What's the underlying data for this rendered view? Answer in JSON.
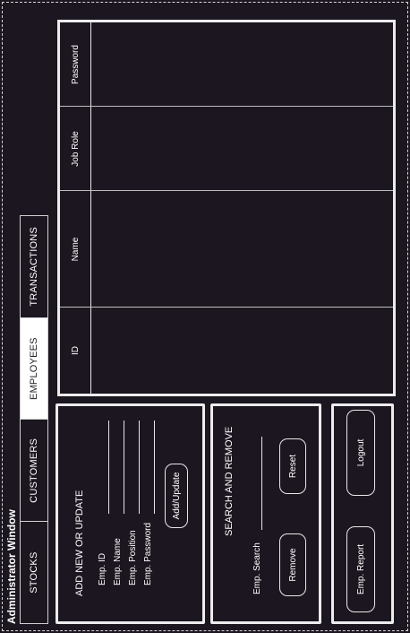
{
  "window": {
    "title": "Administrator Window"
  },
  "tabs": [
    {
      "label": "STOCKS"
    },
    {
      "label": "CUSTOMERS"
    },
    {
      "label": "EMPLOYEES",
      "active": true
    },
    {
      "label": "TRANSACTIONS"
    }
  ],
  "add_update": {
    "title": "ADD NEW OR UPDATE",
    "fields": [
      {
        "label": "Emp. ID"
      },
      {
        "label": "Emp. Name"
      },
      {
        "label": "Emp. Position"
      },
      {
        "label": "Emp. Password"
      }
    ],
    "button": "Add/Update"
  },
  "search_remove": {
    "title": "SEARCH AND REMOVE",
    "search_label": "Emp. Search",
    "remove_button": "Remove",
    "reset_button": "Reset"
  },
  "actions": {
    "report_button": "Emp. Report",
    "logout_button": "Logout"
  },
  "table": {
    "columns": [
      "ID",
      "Name",
      "Job Role",
      "Password"
    ]
  },
  "colors": {
    "background": "#1b161f",
    "border": "#ececec",
    "active_tab": "#ffffff"
  }
}
